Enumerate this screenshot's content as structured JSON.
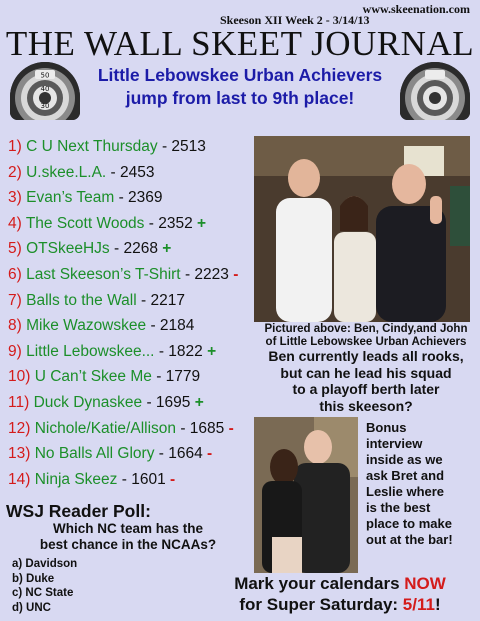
{
  "header": {
    "url": "www.skeenation.com",
    "issue": "Skeeson XII Week 2 - 3/14/13",
    "masthead": "THE WALL SKEET JOURNAL"
  },
  "headline": {
    "line1": "Little Lebowskee Urban Achievers",
    "line2": "jump from last to 9th place!"
  },
  "rankings": [
    {
      "num": "1)",
      "team": "C U Next Thursday",
      "score": "- 2513",
      "trend": ""
    },
    {
      "num": "2)",
      "team": "U.skee.L.A.",
      "score": "- 2453",
      "trend": ""
    },
    {
      "num": "3)",
      "team": "Evan’s Team",
      "score": "- 2369",
      "trend": ""
    },
    {
      "num": "4)",
      "team": "The Scott Woods",
      "score": "- 2352",
      "trend": "+"
    },
    {
      "num": "5)",
      "team": "OTSkeeHJs",
      "score": "- 2268",
      "trend": "+"
    },
    {
      "num": "6)",
      "team": "Last Skeeson’s T-Shirt",
      "score": "- 2223",
      "trend": "-"
    },
    {
      "num": "7)",
      "team": "Balls to the Wall",
      "score": "- 2217",
      "trend": ""
    },
    {
      "num": "8)",
      "team": "Mike Wazowskee",
      "score": "- 2184",
      "trend": ""
    },
    {
      "num": "9)",
      "team": "Little Lebowskee...",
      "score": "- 1822",
      "trend": "+"
    },
    {
      "num": "10)",
      "team": "U Can’t Skee Me",
      "score": "- 1779",
      "trend": ""
    },
    {
      "num": "11)",
      "team": "Duck Dynaskee",
      "score": "- 1695",
      "trend": "+"
    },
    {
      "num": "12)",
      "team": "Nichole/Katie/Allison",
      "score": "- 1685",
      "trend": "-"
    },
    {
      "num": "13)",
      "team": "No Balls All Glory",
      "score": "- 1664",
      "trend": "-"
    },
    {
      "num": "14)",
      "team": "Ninja Skeez",
      "score": "- 1601",
      "trend": "-"
    }
  ],
  "photo_caption": {
    "line1": "Pictured above: Ben, Cindy,and John",
    "line2": "of Little Lebowskee Urban Achievers"
  },
  "rookie_blurb": {
    "line1": "Ben currently leads all rooks,",
    "line2": "but can he lead his squad",
    "line3": "to a playoff berth later",
    "line4": "this skeeson?"
  },
  "bonus": {
    "line1": "Bonus",
    "line2": "interview",
    "line3": "inside as we",
    "line4": "ask Bret and",
    "line5": "Leslie where",
    "line6": "is the best",
    "line7": "place to make",
    "line8": "out at the bar!"
  },
  "poll": {
    "title": "WSJ Reader Poll:",
    "question_line1": "Which NC team has the",
    "question_line2": "best chance in the NCAAs?",
    "options": [
      "a) Davidson",
      "b) Duke",
      "c) NC State",
      "d) UNC"
    ]
  },
  "calendar": {
    "line1_pre": "Mark your calendars ",
    "line1_hl": "NOW",
    "line2_pre": "for Super Saturday: ",
    "line2_hl": "5/11",
    "line2_post": "!"
  },
  "skeeball_labels": [
    "50",
    "40",
    "30"
  ],
  "colors": {
    "background": "#d8d9f2",
    "rank_number": "#d41b1b",
    "team_name": "#1c8f2a",
    "headline": "#1c1ca8",
    "trend_up": "#1c8f2a",
    "trend_down": "#d41b1b"
  }
}
